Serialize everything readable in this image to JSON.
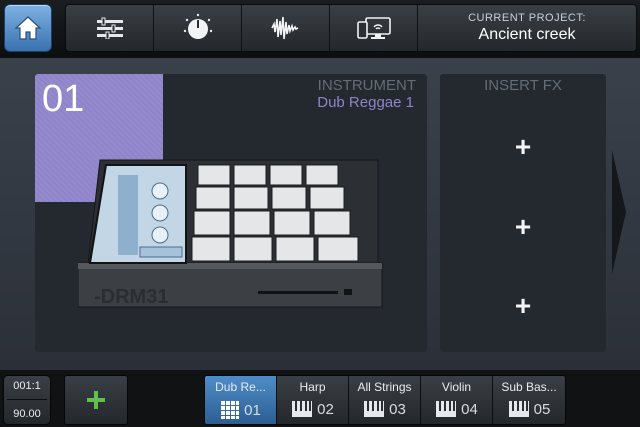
{
  "header": {
    "project_caption": "CURRENT PROJECT:",
    "project_name": "Ancient creek",
    "tools": [
      {
        "icon": "mixer-icon"
      },
      {
        "icon": "knob-icon"
      },
      {
        "icon": "waveform-icon"
      },
      {
        "icon": "device-sync-icon"
      }
    ]
  },
  "instrument": {
    "slot": "01",
    "label": "INSTRUMENT",
    "name": "Dub Reggae 1",
    "device_brand": "-DRM31",
    "accent": "#8f84c9"
  },
  "fx": {
    "label": "INSERT FX",
    "slots": [
      "+",
      "+",
      "+"
    ]
  },
  "transport": {
    "position": "001:1",
    "tempo": "90.00"
  },
  "tracks": [
    {
      "name": "Dub Re...",
      "number": "01",
      "icon": "pads-icon",
      "active": true
    },
    {
      "name": "Harp",
      "number": "02",
      "icon": "keyboard-icon",
      "active": false
    },
    {
      "name": "All Strings",
      "number": "03",
      "icon": "keyboard-icon",
      "active": false
    },
    {
      "name": "Violin",
      "number": "04",
      "icon": "keyboard-icon",
      "active": false
    },
    {
      "name": "Sub Bas...",
      "number": "05",
      "icon": "keyboard-icon",
      "active": false
    }
  ],
  "colors": {
    "accent_blue": "#4f8dc8",
    "add_green": "#5fc04a"
  }
}
